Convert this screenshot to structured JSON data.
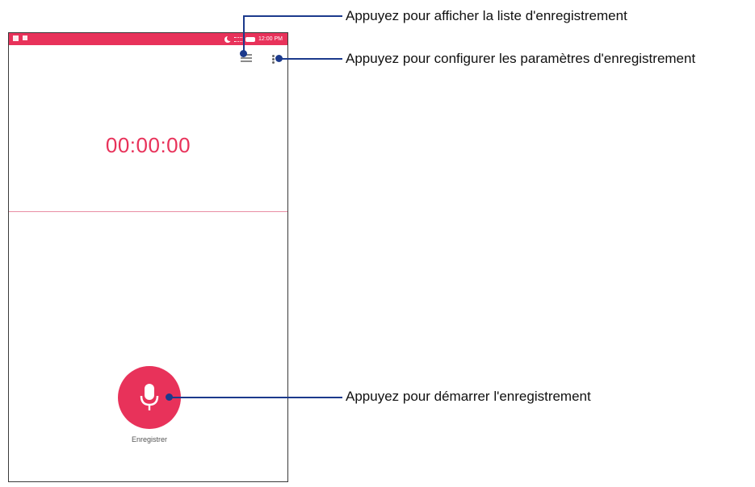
{
  "status_bar": {
    "time": "12:00 PM",
    "color": "#e8325a"
  },
  "toolbar": {
    "list_icon": "list-icon",
    "settings_icon": "more-vert-icon"
  },
  "timer": {
    "value": "00:00:00"
  },
  "record": {
    "label": "Enregistrer",
    "icon": "microphone-icon"
  },
  "callouts": {
    "list": "Appuyez pour afficher la liste d'enregistrement",
    "settings": "Appuyez pour configurer les paramètres d'enregistrement",
    "record": "Appuyez pour démarrer l'enregistrement"
  },
  "colors": {
    "accent": "#e8325a",
    "callout_line": "#1c3a8c"
  }
}
